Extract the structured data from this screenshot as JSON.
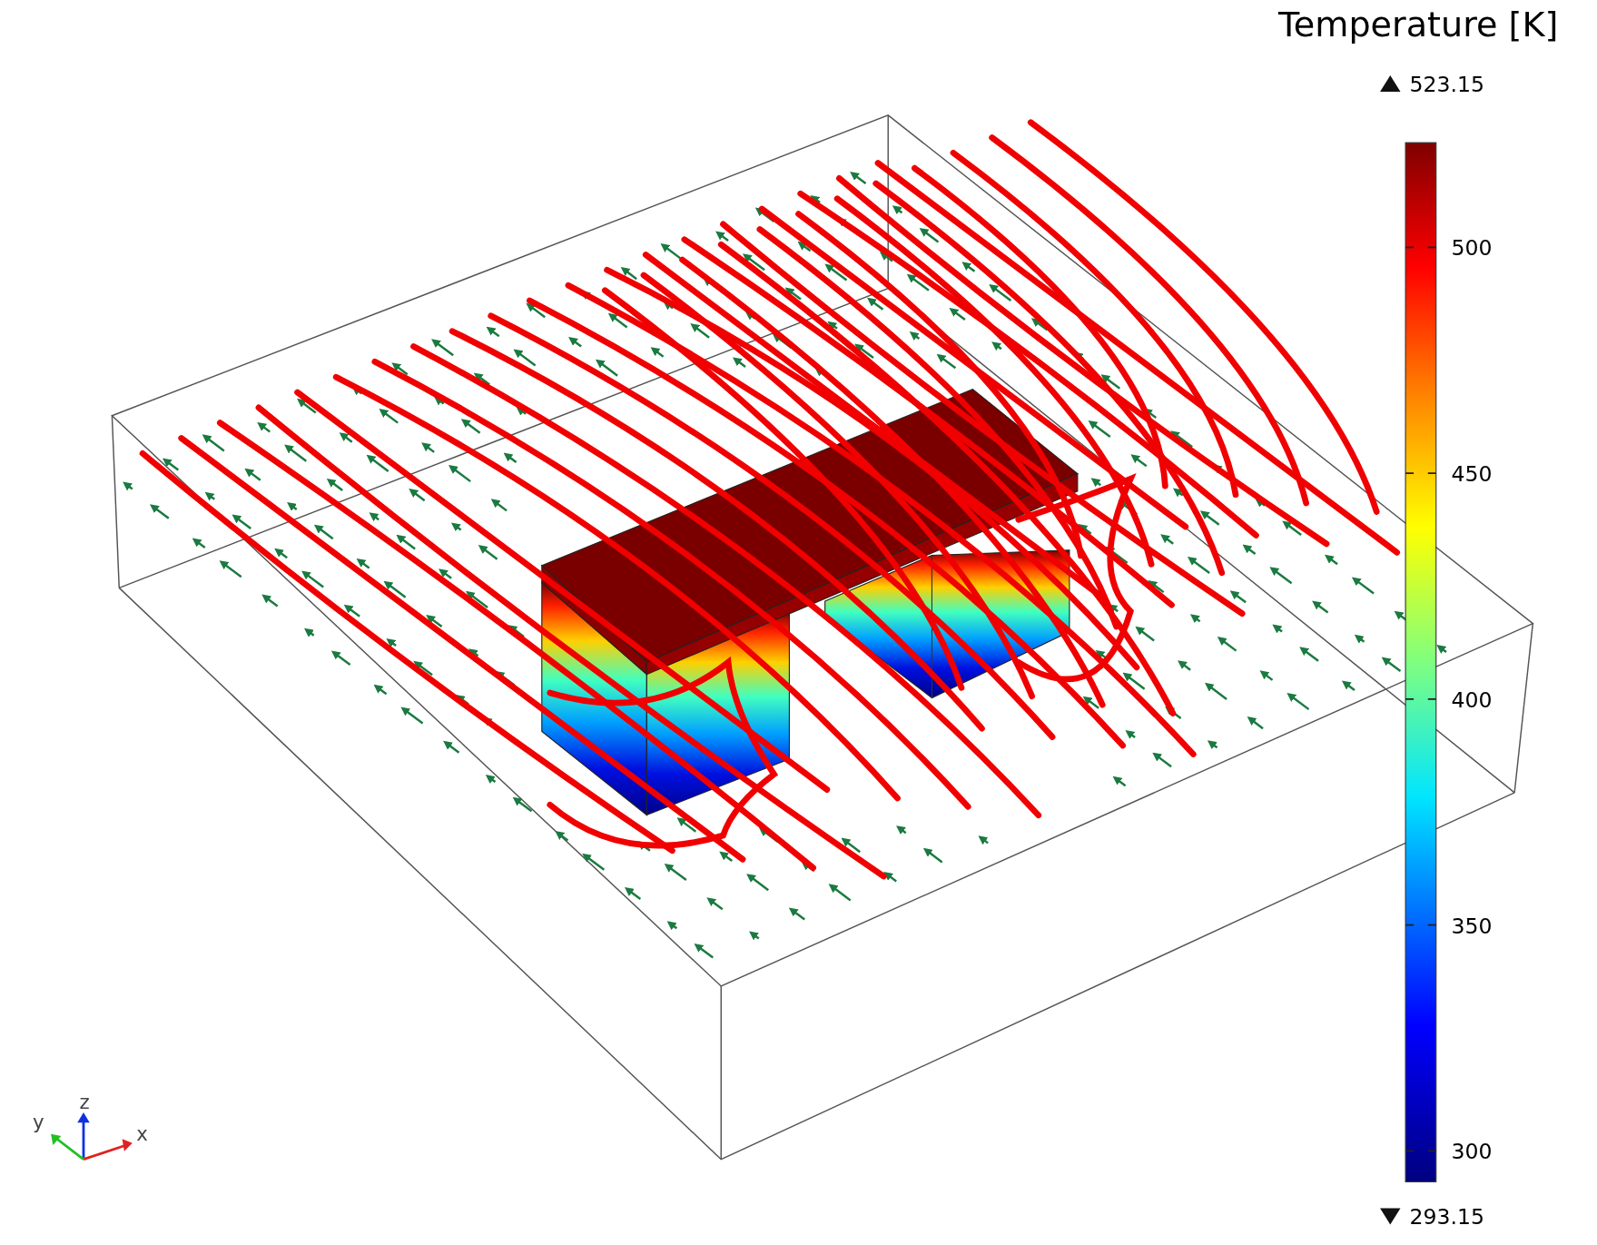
{
  "color_legend": {
    "title": "Temperature [K]",
    "max_label": "523.15",
    "min_label": "293.15",
    "ticks": [
      "500",
      "450",
      "400",
      "350",
      "300"
    ]
  },
  "axis_triad": [
    {
      "label": "y"
    },
    {
      "label": "z"
    },
    {
      "label": "x"
    }
  ]
}
